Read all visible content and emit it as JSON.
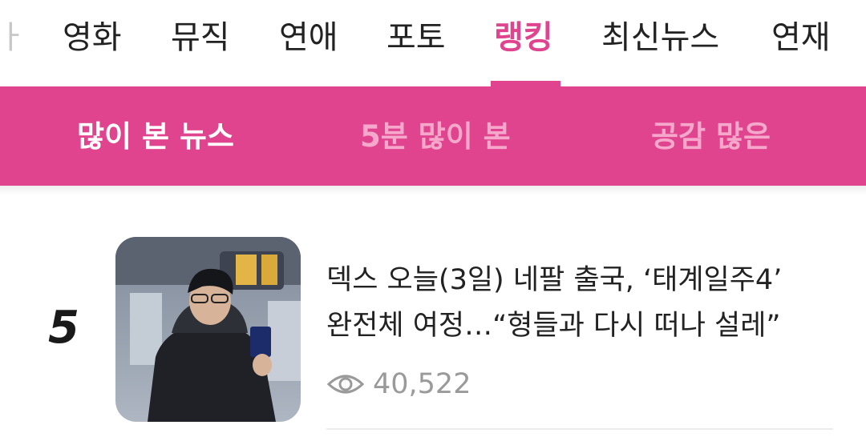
{
  "top_nav": {
    "items": [
      {
        "label": "ㅏ",
        "state": "cut-off"
      },
      {
        "label": "영화",
        "state": "normal"
      },
      {
        "label": "뮤직",
        "state": "normal"
      },
      {
        "label": "연애",
        "state": "normal"
      },
      {
        "label": "포토",
        "state": "normal"
      },
      {
        "label": "랭킹",
        "state": "active"
      },
      {
        "label": "최신뉴스",
        "state": "normal"
      },
      {
        "label": "연재",
        "state": "normal"
      }
    ]
  },
  "sub_tabs": {
    "items": [
      {
        "label": "많이 본 뉴스",
        "state": "active"
      },
      {
        "label": "5분 많이 본",
        "state": "inactive"
      },
      {
        "label": "공감 많은",
        "state": "inactive"
      }
    ]
  },
  "article": {
    "rank": "5",
    "headline_line1": "덱스 오늘(3일) 네팔 출국, ‘태계일주4’",
    "headline_line2": "완전체 여정…“형들과 다시 떠나 설레”",
    "views": "40,522",
    "thumbnail_icon": "photo-thumbnail"
  },
  "colors": {
    "accent": "#e0448e",
    "inactive_tab": "#f5a8cb",
    "text": "#222222",
    "muted": "#9a9a9a"
  }
}
